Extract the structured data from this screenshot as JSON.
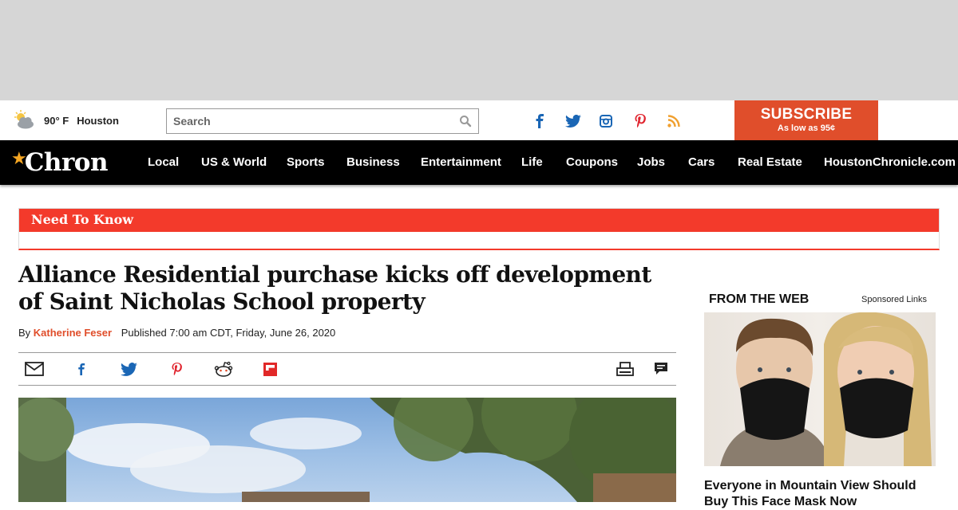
{
  "weather": {
    "temp": "90° F",
    "city": "Houston",
    "icon": "partly-cloudy-icon"
  },
  "search": {
    "placeholder": "Search"
  },
  "social": [
    {
      "name": "facebook-icon"
    },
    {
      "name": "twitter-icon"
    },
    {
      "name": "instagram-icon"
    },
    {
      "name": "pinterest-icon"
    },
    {
      "name": "rss-icon"
    }
  ],
  "subscribe": {
    "label": "SUBSCRIBE",
    "sub": "As low as 95¢"
  },
  "logo": {
    "text": "Chron"
  },
  "nav": [
    "Local",
    "US & World",
    "Sports",
    "Business",
    "Entertainment",
    "Life",
    "Coupons",
    "Jobs",
    "Cars",
    "Real Estate",
    "HoustonChronicle.com"
  ],
  "need_to_know": {
    "title": "Need To Know"
  },
  "article": {
    "headline": "Alliance Residential purchase kicks off development of Saint Nicholas School property",
    "by": "By",
    "author": "Katherine Feser",
    "published": "Published 7:00 am CDT, Friday, June 26, 2020"
  },
  "share_icons": [
    "email-icon",
    "facebook-icon",
    "twitter-icon",
    "pinterest-icon",
    "reddit-icon",
    "flipboard-icon",
    "print-icon",
    "comments-icon"
  ],
  "sidebar": {
    "heading": "FROM THE WEB",
    "sponsored": "Sponsored Links",
    "promo_title": "Everyone in Mountain View Should Buy This Face Mask Now"
  },
  "colors": {
    "accent": "#e04e2b",
    "ntk_red": "#f33a2b",
    "nav_bg": "#000000",
    "ad_gray": "#d6d6d6"
  }
}
